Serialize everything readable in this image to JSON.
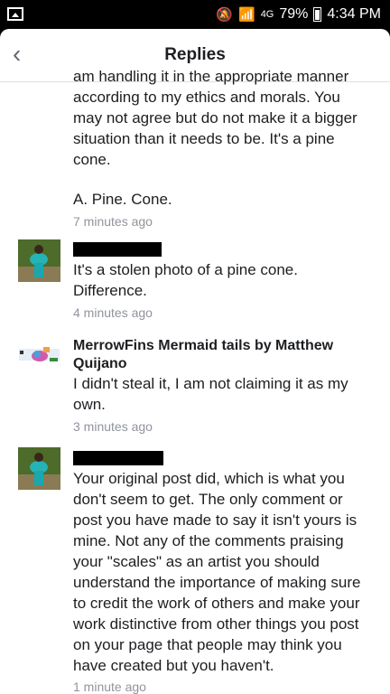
{
  "status": {
    "time": "4:34 PM",
    "battery": "79%",
    "network": "4G"
  },
  "header": {
    "title": "Replies"
  },
  "comments": [
    {
      "text": "am handling it in the appropriate manner according to my ethics and morals. You may not agree but do not make it a bigger situation than it needs to be. It's a pine cone.",
      "text2": "A. Pine. Cone.",
      "time": "7 minutes ago"
    },
    {
      "text": "It's a stolen photo of a pine cone. Difference.",
      "time": "4 minutes ago"
    },
    {
      "name": "MerrowFins Mermaid tails by Matthew Quijano",
      "text": "I didn't steal it, I am not claiming it as my own.",
      "time": "3 minutes ago"
    },
    {
      "text": "Your original post did, which is what you don't seem to get. The only comment or post you have made to say it isn't yours is mine. Not any of the comments praising your \"scales\" as an artist you should understand the importance of making sure to credit the work of others and make your work distinctive from other things you post on your page that people may think you have created but you haven't.",
      "time": "1 minute ago"
    }
  ]
}
